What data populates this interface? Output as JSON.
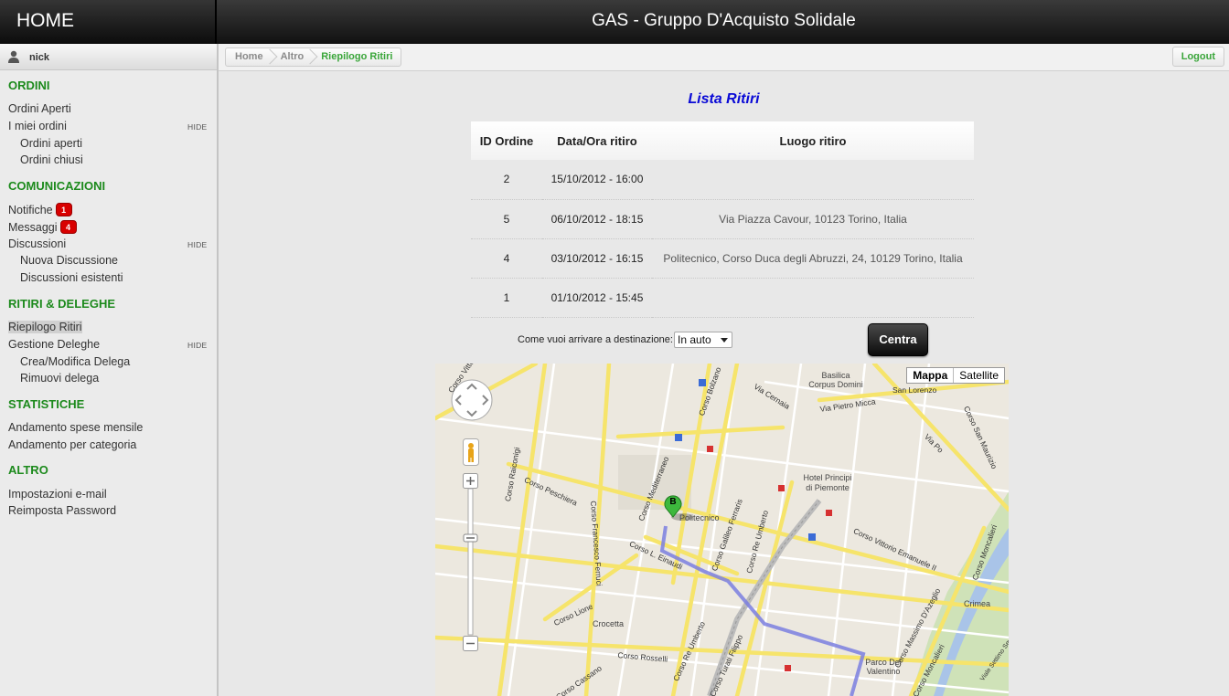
{
  "header": {
    "home": "HOME",
    "title": "GAS - Gruppo D'Acquisto Solidale"
  },
  "user": {
    "name": "nick"
  },
  "sidebar": {
    "ordini": {
      "title": "ORDINI",
      "aperti": "Ordini Aperti",
      "miei": "I miei ordini",
      "hide": "HIDE",
      "sub_aperti": "Ordini aperti",
      "sub_chiusi": "Ordini chiusi"
    },
    "comunicazioni": {
      "title": "COMUNICAZIONI",
      "notifiche": "Notifiche",
      "notifiche_count": "1",
      "messaggi": "Messaggi",
      "messaggi_count": "4",
      "discussioni": "Discussioni",
      "hide": "HIDE",
      "nuova": "Nuova Discussione",
      "esistenti": "Discussioni esistenti"
    },
    "ritiri": {
      "title": "RITIRI & DELEGHE",
      "riepilogo": "Riepilogo Ritiri",
      "gestione": "Gestione Deleghe",
      "hide": "HIDE",
      "crea": "Crea/Modifica Delega",
      "rimuovi": "Rimuovi delega"
    },
    "statistiche": {
      "title": "STATISTICHE",
      "mensile": "Andamento spese mensile",
      "categoria": "Andamento per categoria"
    },
    "altro": {
      "title": "ALTRO",
      "email": "Impostazioni e-mail",
      "password": "Reimposta Password"
    }
  },
  "breadcrumb": [
    "Home",
    "Altro",
    "Riepilogo Ritiri"
  ],
  "logout": "Logout",
  "main": {
    "title": "Lista Ritiri",
    "columns": [
      "ID Ordine",
      "Data/Ora ritiro",
      "Luogo ritiro"
    ],
    "rows": [
      {
        "id": "2",
        "date": "15/10/2012 - 16:00",
        "place": ""
      },
      {
        "id": "5",
        "date": "06/10/2012 - 18:15",
        "place": "Via Piazza Cavour, 10123 Torino, Italia"
      },
      {
        "id": "4",
        "date": "03/10/2012 - 16:15",
        "place": "Politecnico, Corso Duca degli Abruzzi, 24, 10129 Torino, Italia"
      },
      {
        "id": "1",
        "date": "01/10/2012 - 15:45",
        "place": ""
      }
    ],
    "destination_label": "Come vuoi arrivare a destinazione:",
    "destination_value": "In auto",
    "centra": "Centra"
  },
  "map": {
    "type_map": "Mappa",
    "type_satellite": "Satellite",
    "marker": "B",
    "labels": {
      "vittorio_emanuele_left": "Corso Vittorio Emanuele II",
      "bolzano": "Corso Bolzano",
      "cernaia": "Via Cernaia",
      "pietro_micca": "Via Pietro Micca",
      "basilica": "Basilica Corpus Domini",
      "san_lorenzo": "San Lorenzo",
      "rui": "Corso Raiconigi",
      "ferrucci": "Corso Francesco Ferruci",
      "peschiera": "Corso Peschiera",
      "mediterraneo": "Corso Mediterraneo",
      "politecnico": "Politecnico",
      "einaudi": "Corso L. Einaudi",
      "galileo": "Corso Galileo Ferraris",
      "re_umberto": "Corso Re Umberto",
      "hotel": "Hotel Principi di Piemonte",
      "vittorio_emanuele_right": "Corso Vittorio Emanuele II",
      "po": "Via Po",
      "san_maurizio": "Corso San Maurizio",
      "moncalieri": "Corso Moncalieri",
      "massimo": "Corso Massimo D'Azeglio",
      "crimea": "Crimea",
      "lione": "Corso Lione",
      "crocetta": "Crocetta",
      "rosselli": "Corso Rosselli",
      "re_umberto_low": "Corso Re Umberto",
      "turati": "Corso Turati Filippo",
      "valentino": "Parco Del Valentino",
      "cassano": "Corso Cassano",
      "viale": "Viale Settimo Severo",
      "moncalieri_low": "Corso Moncalieri"
    }
  }
}
